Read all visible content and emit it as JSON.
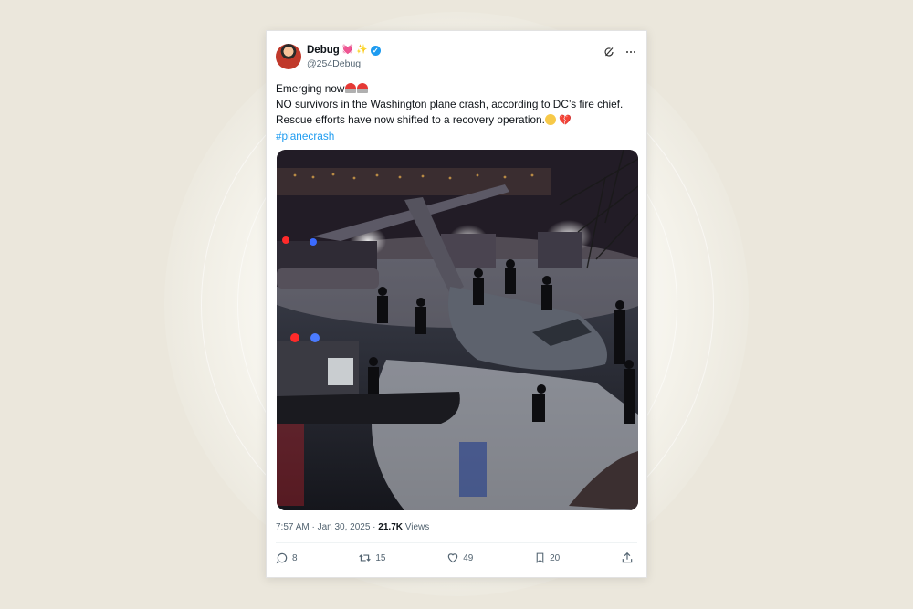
{
  "post": {
    "display_name": "Debug",
    "name_emojis": [
      "💓",
      "✨"
    ],
    "handle": "@254Debug",
    "text": {
      "line1": "Emerging now",
      "line2": "NO survivors in the Washington plane crash, according to DC’s fire chief.",
      "line3": "Rescue efforts have now shifted to a recovery operation.",
      "hashtag": "#planecrash"
    },
    "time": "7:57 AM · Jan 30, 2025 · ",
    "views_count": "21.7K",
    "views_label": " Views"
  },
  "actions": {
    "replies": "8",
    "reposts": "15",
    "likes": "49",
    "bookmarks": "20"
  },
  "icons": [
    "grok-icon",
    "more-icon",
    "reply-icon",
    "repost-icon",
    "like-icon",
    "bookmark-icon",
    "share-icon",
    "verified-badge-icon"
  ],
  "colors": {
    "link": "#1d9bf0",
    "secondary_text": "#536471",
    "primary_text": "#0f1419"
  }
}
